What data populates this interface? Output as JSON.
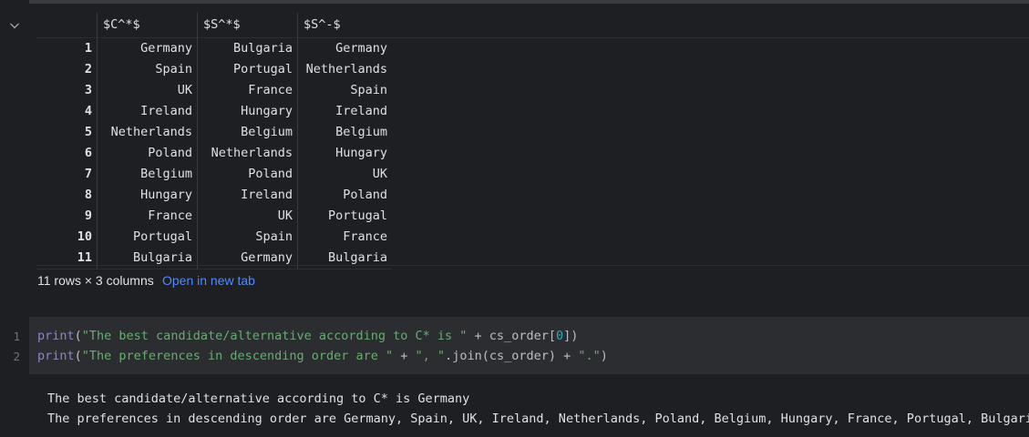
{
  "table": {
    "columns": [
      "$C^*$",
      "$S^*$",
      "$S^-$"
    ],
    "rows": [
      {
        "idx": "1",
        "c": "Germany",
        "s": "Bulgaria",
        "sm": "Germany"
      },
      {
        "idx": "2",
        "c": "Spain",
        "s": "Portugal",
        "sm": "Netherlands"
      },
      {
        "idx": "3",
        "c": "UK",
        "s": "France",
        "sm": "Spain"
      },
      {
        "idx": "4",
        "c": "Ireland",
        "s": "Hungary",
        "sm": "Ireland"
      },
      {
        "idx": "5",
        "c": "Netherlands",
        "s": "Belgium",
        "sm": "Belgium"
      },
      {
        "idx": "6",
        "c": "Poland",
        "s": "Netherlands",
        "sm": "Hungary"
      },
      {
        "idx": "7",
        "c": "Belgium",
        "s": "Poland",
        "sm": "UK"
      },
      {
        "idx": "8",
        "c": "Hungary",
        "s": "Ireland",
        "sm": "Poland"
      },
      {
        "idx": "9",
        "c": "France",
        "s": "UK",
        "sm": "Portugal"
      },
      {
        "idx": "10",
        "c": "Portugal",
        "s": "Spain",
        "sm": "France"
      },
      {
        "idx": "11",
        "c": "Bulgaria",
        "s": "Germany",
        "sm": "Bulgaria"
      }
    ],
    "shape_info": "11 rows × 3 columns",
    "open_link": "Open in new tab"
  },
  "code": {
    "line_numbers": [
      "1",
      "2"
    ],
    "line1": {
      "fn": "print",
      "p1": "(",
      "s1": "\"The best candidate/alternative according to C* is \"",
      "p2": " + cs_order[",
      "n": "0",
      "p3": "])"
    },
    "line2": {
      "fn": "print",
      "p1": "(",
      "s1": "\"The preferences in descending order are \"",
      "p2": " + ",
      "s2": "\", \"",
      "p3": ".join(cs_order) + ",
      "s3": "\".\"",
      "p4": ")"
    }
  },
  "output": {
    "line1": "The best candidate/alternative according to C* is Germany",
    "line2": "The preferences in descending order are Germany, Spain, UK, Ireland, Netherlands, Poland, Belgium, Hungary, France, Portugal, Bulgaria."
  },
  "icons": {
    "collapse": "chevron-down-icon"
  },
  "colors": {
    "background": "#1e1f22",
    "code_bg": "#2b2d30",
    "link": "#548af7",
    "string": "#6aab73",
    "keyword": "#8888c6",
    "number": "#2aacb8"
  }
}
